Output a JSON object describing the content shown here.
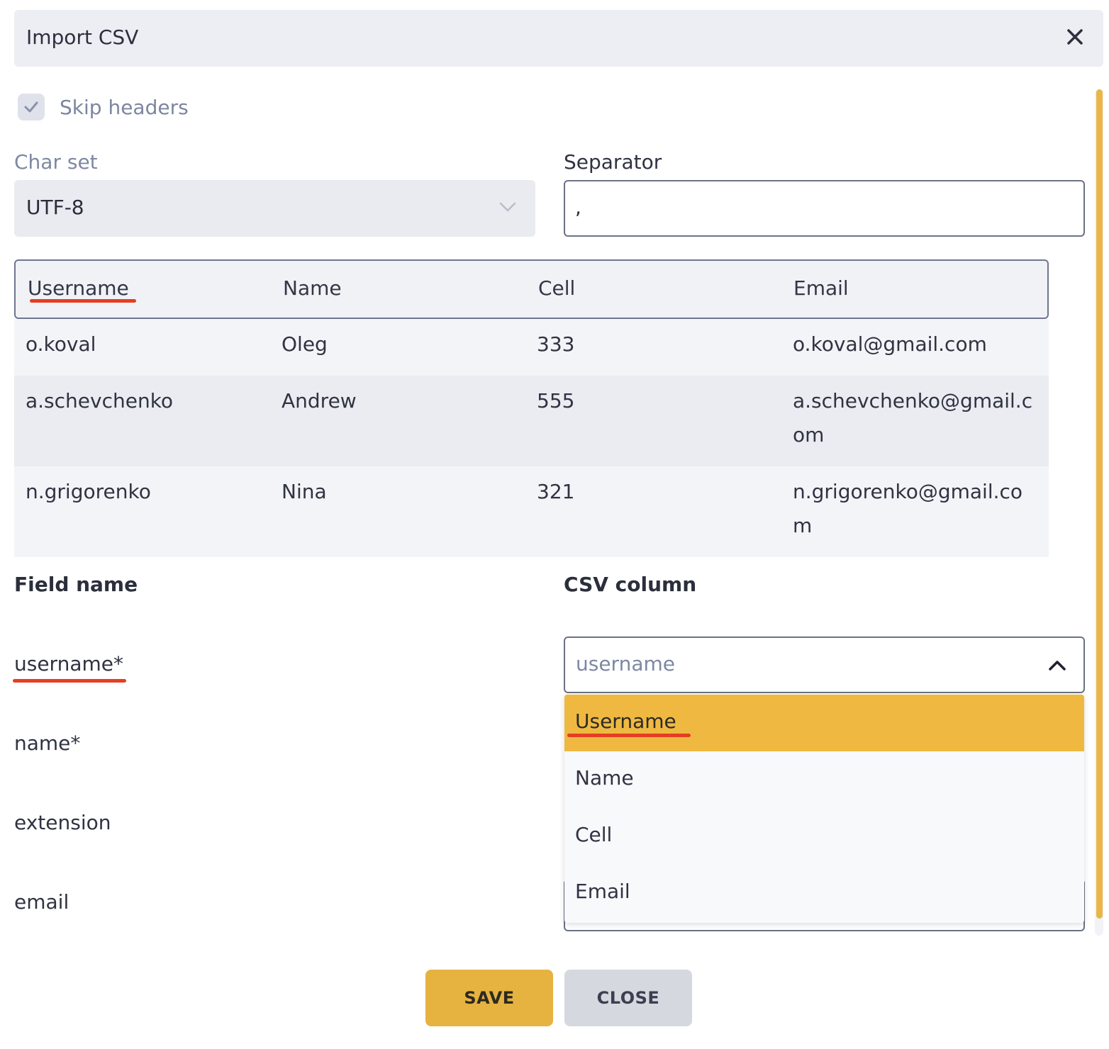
{
  "dialog": {
    "title": "Import CSV",
    "close_icon": "close-icon"
  },
  "options": {
    "skip_headers_label": "Skip headers",
    "skip_headers_checked": true,
    "charset_label": "Char set",
    "charset_value": "UTF-8",
    "separator_label": "Separator",
    "separator_value": ","
  },
  "preview": {
    "columns": [
      "Username",
      "Name",
      "Cell",
      "Email"
    ],
    "rows": [
      [
        "o.koval",
        "Oleg",
        "333",
        "o.koval@gmail.com"
      ],
      [
        "a.schevchenko",
        "Andrew",
        "555",
        "a.schevchenko@gmail.com"
      ],
      [
        "n.grigorenko",
        "Nina",
        "321",
        "n.grigorenko@gmail.com"
      ]
    ]
  },
  "mapping": {
    "field_header": "Field name",
    "column_header": "CSV column",
    "fields": [
      "username*",
      "name*",
      "extension",
      "email"
    ],
    "selected_placeholder": "username",
    "dropdown_options": [
      "Username",
      "Name",
      "Cell",
      "Email"
    ],
    "highlighted_option": "Username"
  },
  "buttons": {
    "save": "SAVE",
    "close": "CLOSE"
  },
  "colors": {
    "accent": "#e6b341",
    "annotation_underline": "#e53d24",
    "header_bg": "#edeef3"
  }
}
